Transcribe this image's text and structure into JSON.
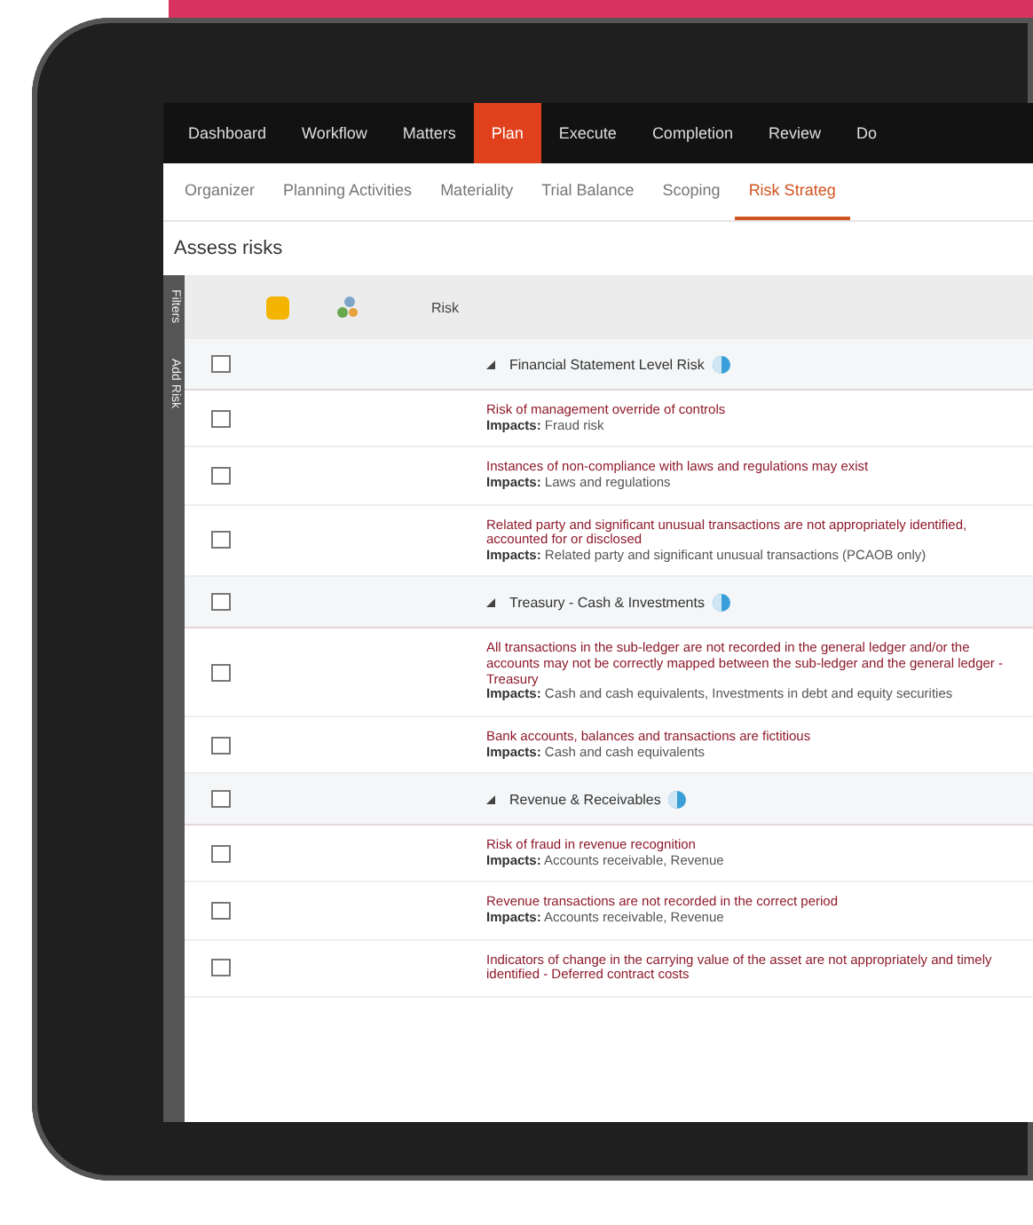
{
  "nav": [
    {
      "label": "Dashboard",
      "selected": false
    },
    {
      "label": "Workflow",
      "selected": false
    },
    {
      "label": "Matters",
      "selected": false
    },
    {
      "label": "Plan",
      "selected": true
    },
    {
      "label": "Execute",
      "selected": false
    },
    {
      "label": "Completion",
      "selected": false
    },
    {
      "label": "Review",
      "selected": false
    },
    {
      "label": "Do",
      "selected": false
    }
  ],
  "subnav": [
    {
      "label": "Organizer",
      "selected": false
    },
    {
      "label": "Planning Activities",
      "selected": false
    },
    {
      "label": "Materiality",
      "selected": false
    },
    {
      "label": "Trial Balance",
      "selected": false
    },
    {
      "label": "Scoping",
      "selected": false
    },
    {
      "label": "Risk Strateg",
      "selected": true
    }
  ],
  "title": "Assess risks",
  "side_tabs": [
    "Filters",
    "Add Risk"
  ],
  "table": {
    "column_header": "Risk",
    "groups": [
      {
        "name": "Financial Statement Level Risk",
        "expanded": true,
        "checked": false,
        "risks": [
          {
            "title": "Risk of management override of controls",
            "impacts": "**Impacts:** Fraud risk",
            "checked": false
          },
          {
            "title": "Instances of non-compliance with laws and regulations may exist",
            "impacts": "**Impacts:** Laws and regulations",
            "checked": false
          },
          {
            "title": "Related party and significant unusual transactions are not appropriately identified, accounted for or disclosed",
            "impacts": "**Impacts:** Related party and significant unusual transactions (PCAOB only)",
            "checked": false
          }
        ]
      },
      {
        "name": "Treasury - Cash & Investments",
        "expanded": true,
        "checked": false,
        "risks": [
          {
            "title": "All transactions in the sub-ledger are not recorded in the general ledger and/or the accounts may not be correctly mapped between the sub-ledger and the general ledger - Treasury",
            "impacts": "**Impacts:** Cash and cash equivalents, Investments in debt and equity securities",
            "checked": false
          },
          {
            "title": "Bank accounts, balances and transactions are fictitious",
            "impacts": "**Impacts:** Cash and cash equivalents",
            "checked": false
          }
        ]
      },
      {
        "name": "Revenue & Receivables",
        "expanded": true,
        "checked": false,
        "risks": [
          {
            "title": "Risk of fraud in revenue recognition",
            "impacts": "**Impacts:** Accounts receivable, Revenue",
            "checked": false
          },
          {
            "title": "Revenue transactions are not recorded in the correct period",
            "impacts": "**Impacts:** Accounts receivable, Revenue",
            "checked": false
          },
          {
            "title": "Indicators of change in the carrying value of the asset are not appropriately and timely identified - Deferred contract costs",
            "checked": false
          }
        ]
      }
    ]
  }
}
